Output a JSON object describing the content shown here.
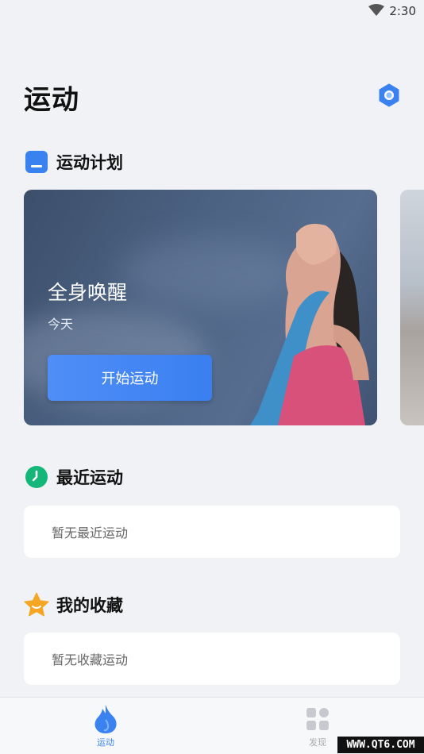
{
  "status": {
    "time": "2:30"
  },
  "header": {
    "title": "运动"
  },
  "plan": {
    "title": "运动计划",
    "card": {
      "name": "全身唤醒",
      "subtitle": "今天",
      "button": "开始运动"
    }
  },
  "recent": {
    "title": "最近运动",
    "empty": "暂无最近运动"
  },
  "favorites": {
    "title": "我的收藏",
    "empty": "暂无收藏运动"
  },
  "tabs": [
    {
      "label": "运动",
      "icon": "flame-icon",
      "active": true
    },
    {
      "label": "发现",
      "icon": "grid-icon",
      "active": false
    }
  ],
  "watermark": "WWW.QT6.COM",
  "colors": {
    "accent": "#3a82f0",
    "success": "#15b67a",
    "star": "#f5a623"
  }
}
